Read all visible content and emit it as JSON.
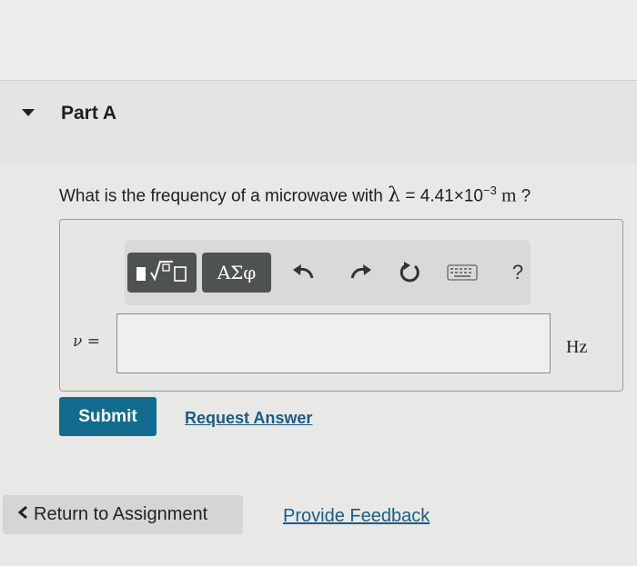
{
  "part": {
    "title": "Part A"
  },
  "question": {
    "prefix": "What is the frequency of a microwave with ",
    "symbol": "λ",
    "equals": " = 4.41×10",
    "exponent": "−3",
    "unit": " m",
    "suffix": " ?"
  },
  "toolbar": {
    "templates_icon": "templates-icon",
    "greek_label": "ΑΣφ",
    "undo_icon": "undo-icon",
    "redo_icon": "redo-icon",
    "reset_icon": "reset-icon",
    "keyboard_icon": "keyboard-icon",
    "help_label": "?"
  },
  "answer": {
    "variable_label": "ν =",
    "value": "",
    "unit": "Hz"
  },
  "actions": {
    "submit_label": "Submit",
    "request_answer_label": "Request Answer"
  },
  "footer": {
    "return_label": "Return to Assignment",
    "feedback_label": "Provide Feedback"
  },
  "colors": {
    "submit_bg": "#126c8f",
    "link": "#1d5b86",
    "toolbar_button": "#4f5253"
  }
}
